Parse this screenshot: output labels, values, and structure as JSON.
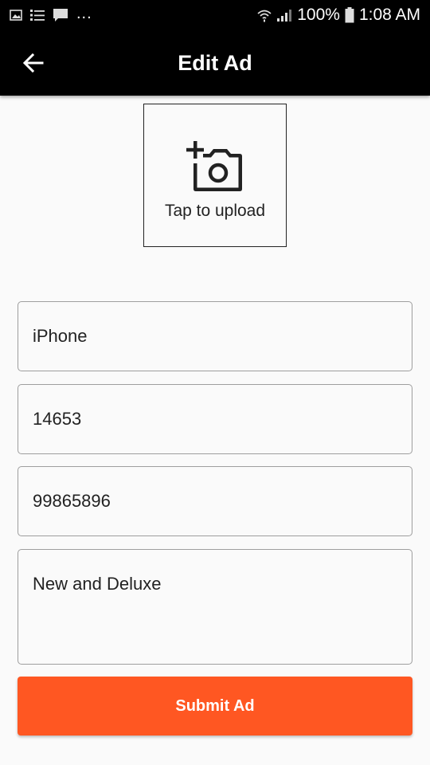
{
  "status_bar": {
    "icons_left": [
      "image-icon",
      "list-icon",
      "message-icon"
    ],
    "overflow": "...",
    "icons_right": [
      "wifi-icon",
      "signal-icon",
      "battery-icon"
    ],
    "battery": "100%",
    "time": "1:08 AM"
  },
  "app_bar": {
    "title": "Edit Ad",
    "back_icon": "arrow-left-icon"
  },
  "upload": {
    "icon": "add-photo-icon",
    "label": "Tap to upload"
  },
  "form": {
    "title_value": "iPhone",
    "price_value": "14653",
    "phone_value": "99865896",
    "description_value": "New and Deluxe"
  },
  "submit": {
    "label": "Submit Ad"
  },
  "colors": {
    "app_bar": "#000000",
    "accent": "#ff5722",
    "background": "#fafafa",
    "field_border": "#9e9e9e"
  }
}
